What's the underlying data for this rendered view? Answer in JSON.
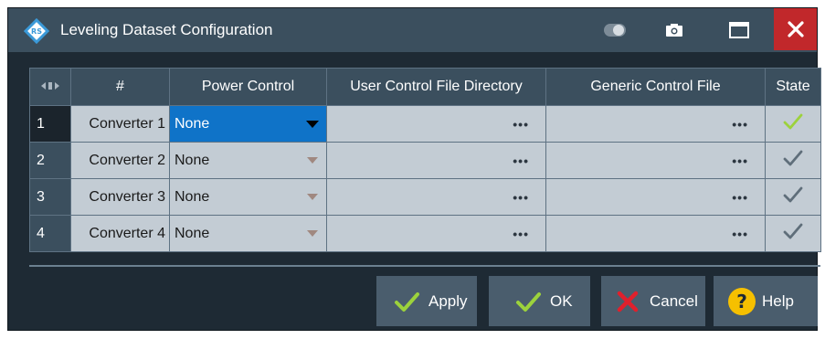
{
  "window": {
    "title": "Leveling Dataset Configuration",
    "icons": [
      "app-logo-icon",
      "toggle-icon",
      "camera-icon",
      "maximize-icon",
      "close-icon"
    ]
  },
  "table": {
    "columns": [
      "#",
      "Power Control",
      "User Control File Directory",
      "Generic Control File",
      "State"
    ],
    "rows": [
      {
        "num": "1",
        "converter": "Converter 1",
        "power_control": "None",
        "user_dir": "•••",
        "generic_file": "•••"
      },
      {
        "num": "2",
        "converter": "Converter 2",
        "power_control": "None",
        "user_dir": "•••",
        "generic_file": "•••"
      },
      {
        "num": "3",
        "converter": "Converter 3",
        "power_control": "None",
        "user_dir": "•••",
        "generic_file": "•••"
      },
      {
        "num": "4",
        "converter": "Converter 4",
        "power_control": "None",
        "user_dir": "•••",
        "generic_file": "•••"
      }
    ]
  },
  "buttons": {
    "apply": "Apply",
    "ok": "OK",
    "cancel": "Cancel",
    "help": "Help"
  },
  "colors": {
    "titlebar": "#3b4f5e",
    "close": "#c1282b",
    "selected": "#0f73c8",
    "check_active": "#9cd23c",
    "check": "#5f6e7a",
    "help_icon": "#f6c000",
    "cancel_icon": "#e0202c"
  }
}
